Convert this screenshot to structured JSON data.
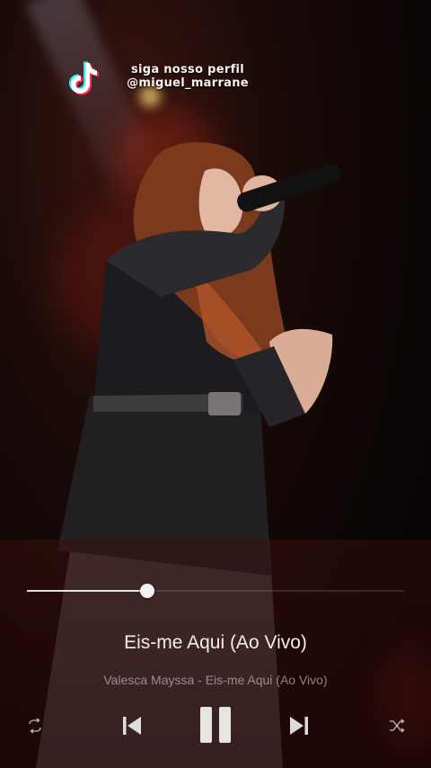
{
  "watermark": {
    "line1": "siga nosso perfil",
    "line2": "@miguel_marrane"
  },
  "player": {
    "elapsed": "",
    "duration": "",
    "progress_fraction": 0.32,
    "title": "Eis-me Aqui (Ao Vivo)",
    "subtitle": "Valesca Mayssa - Eis-me Aqui (Ao Vivo)",
    "controls": {
      "repeat": "repeat-icon",
      "previous": "skip-previous-icon",
      "play_pause": "pause-icon",
      "next": "skip-next-icon",
      "shuffle": "shuffle-icon"
    }
  },
  "colors": {
    "accent": "#f2f2f2",
    "background": "#0b0505",
    "stage_light": "#be3214"
  }
}
